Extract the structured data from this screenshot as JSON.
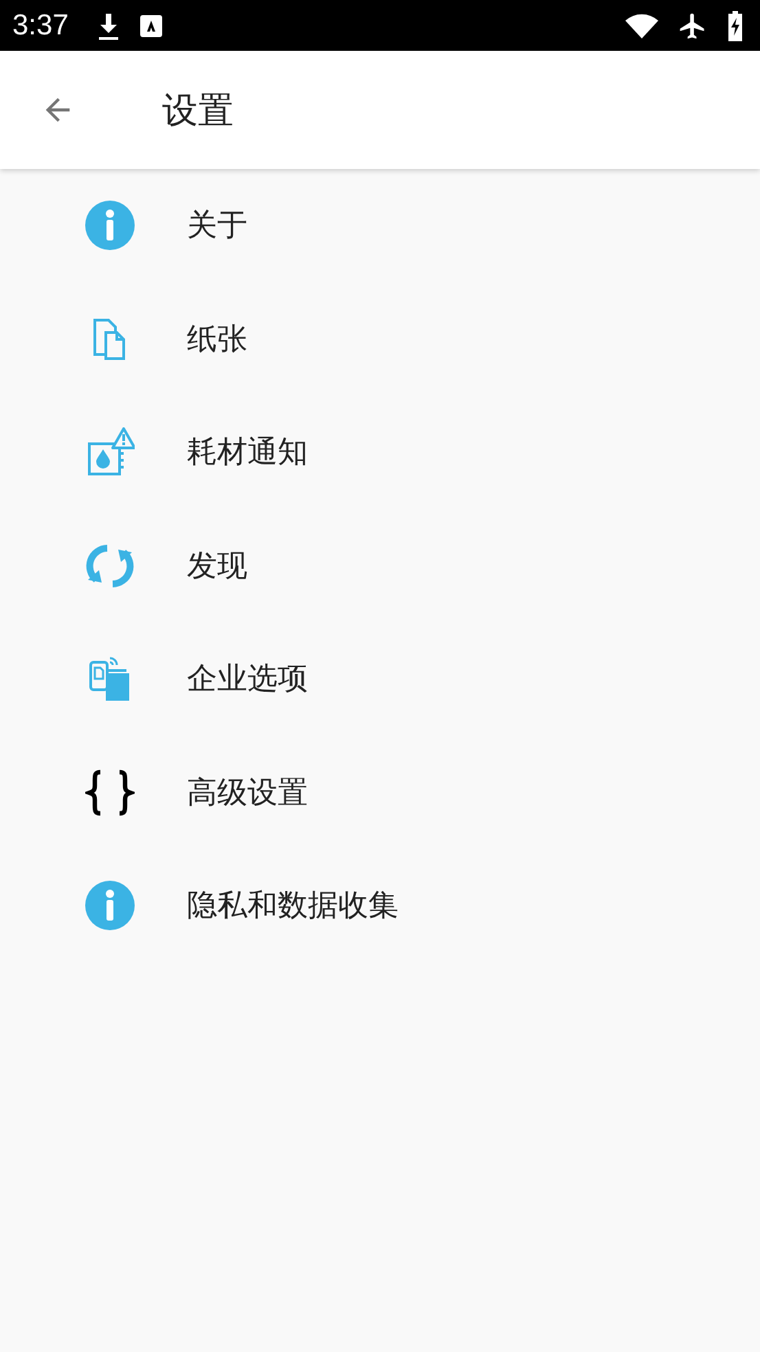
{
  "status_bar": {
    "time": "3:37"
  },
  "app_bar": {
    "title": "设置"
  },
  "items": [
    {
      "label": "关于",
      "kind": "info"
    },
    {
      "label": "纸张",
      "kind": "paper"
    },
    {
      "label": "耗材通知",
      "kind": "supplies"
    },
    {
      "label": "发现",
      "kind": "discover"
    },
    {
      "label": "企业选项",
      "kind": "enterprise"
    },
    {
      "label": "高级设置",
      "kind": "braces"
    },
    {
      "label": "隐私和数据收集",
      "kind": "info"
    }
  ]
}
